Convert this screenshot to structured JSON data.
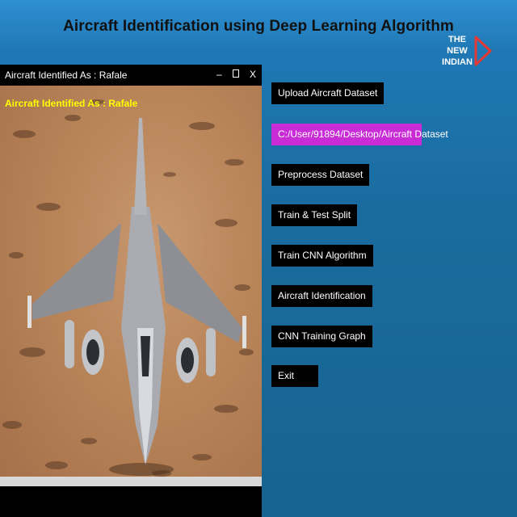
{
  "header": {
    "title": "Aircraft Identification using Deep Learning Algorithm"
  },
  "brand": {
    "line1": "THE",
    "line2": "NEW",
    "line3": "INDIAN",
    "play_color": "#e53935"
  },
  "child_window": {
    "title": "Aircraft Identified As : Rafale",
    "caption": "Aircraft Identified As : Rafale",
    "controls": {
      "minimize": "–",
      "maximize": "▫",
      "close": "X"
    }
  },
  "buttons": {
    "upload": "Upload Aircraft Dataset",
    "path": "C:/User/91894/Desktop/Aircraft Dataset",
    "preprocess": "Preprocess Dataset",
    "split": "Train & Test Split",
    "train_cnn": "Train CNN Algorithm",
    "identify": "Aircraft Identification",
    "graph": "CNN Training Graph",
    "exit": "Exit"
  },
  "colors": {
    "background": "#1a6c9f",
    "caption": "#ffff00",
    "path_highlight": "#c92bd6"
  }
}
